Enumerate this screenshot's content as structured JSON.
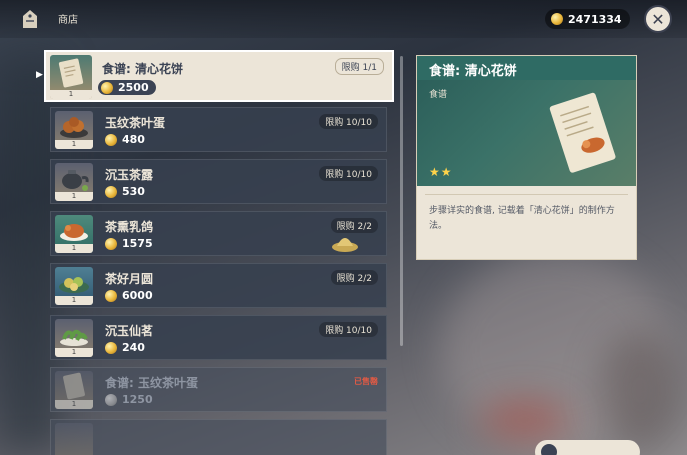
{
  "header": {
    "title": "商店",
    "currency_amount": "2471334",
    "shop_icon": "shopping-bag-icon",
    "close_icon": "close-icon"
  },
  "items": [
    {
      "name": "食谱: 清心花饼",
      "price": "2500",
      "limit": "限购 1/1",
      "qty": "1",
      "selected": true,
      "icon": "recipe-scroll-icon"
    },
    {
      "name": "玉纹茶叶蛋",
      "price": "480",
      "limit": "限购 10/10",
      "qty": "1",
      "icon": "tea-egg-icon"
    },
    {
      "name": "沉玉茶露",
      "price": "530",
      "limit": "限购 10/10",
      "qty": "1",
      "icon": "teapot-icon"
    },
    {
      "name": "茶熏乳鸽",
      "price": "1575",
      "limit": "限购 2/2",
      "qty": "1",
      "icon": "pigeon-dish-icon"
    },
    {
      "name": "茶好月圆",
      "price": "6000",
      "limit": "限购 2/2",
      "qty": "1",
      "icon": "mooncake-icon"
    },
    {
      "name": "沉玉仙茗",
      "price": "240",
      "limit": "限购 10/10",
      "qty": "1",
      "icon": "tea-leaf-icon"
    },
    {
      "name": "食谱: 玉纹茶叶蛋",
      "price": "1250",
      "sold": "已售罄",
      "qty": "1",
      "icon": "recipe-scroll-icon"
    }
  ],
  "detail": {
    "title": "食谱: 清心花饼",
    "type": "食谱",
    "stars": "★★",
    "description": "步骤详实的食谱, 记载着「清心花饼」的制作方法。"
  },
  "colors": {
    "accent": "#2f6b64",
    "panel": "#ece5d8",
    "sold_out": "#e05a45",
    "star": "#ffd34a"
  }
}
